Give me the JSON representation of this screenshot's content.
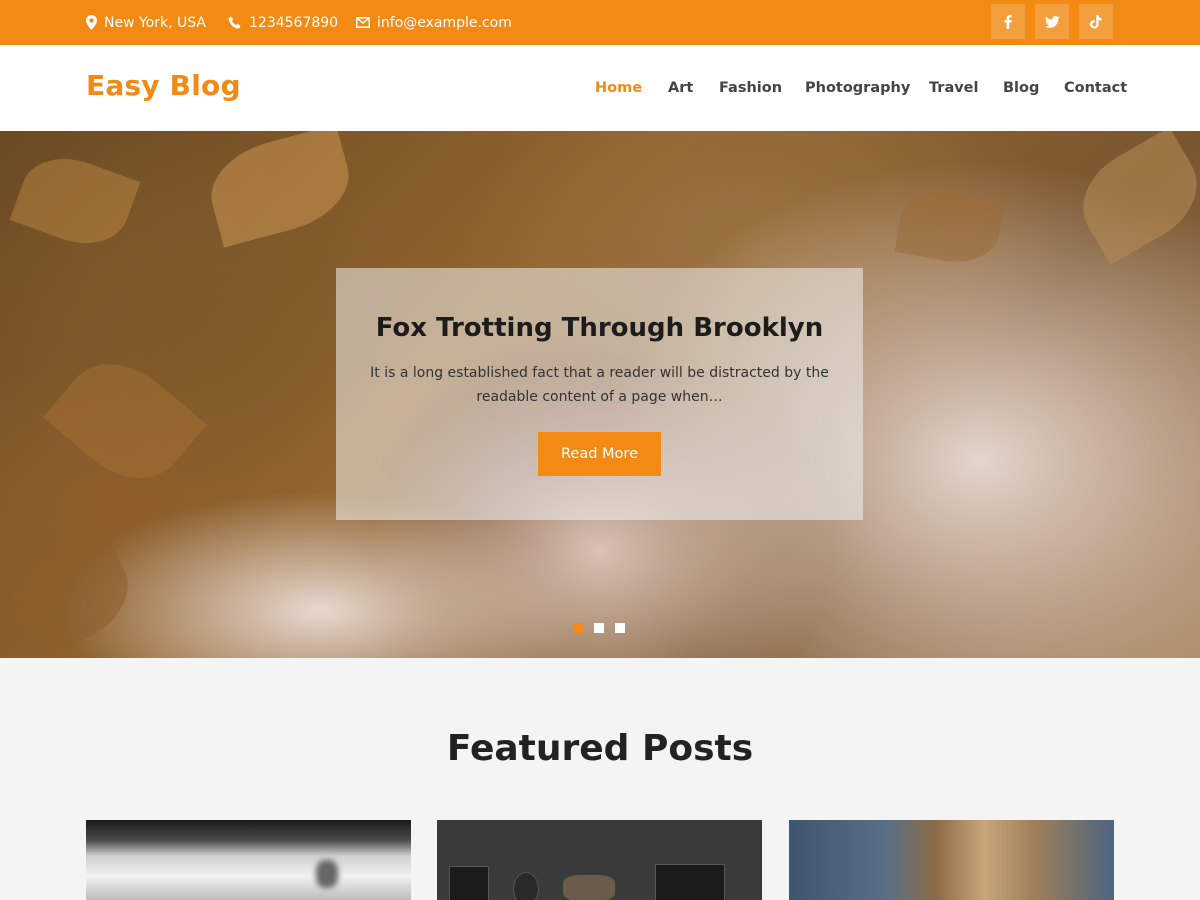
{
  "topbar": {
    "location": "New York, USA",
    "phone": "1234567890",
    "email": "info@example.com",
    "social": [
      "facebook-icon",
      "twitter-icon",
      "tiktok-icon"
    ],
    "bg_color": "#f28a14"
  },
  "header": {
    "logo": "Easy Blog",
    "nav": [
      {
        "label": "Home",
        "active": true
      },
      {
        "label": "Art"
      },
      {
        "label": "Fashion"
      },
      {
        "label": "Photography"
      },
      {
        "label": "Travel"
      },
      {
        "label": "Blog"
      },
      {
        "label": "Contact"
      }
    ]
  },
  "hero": {
    "title": "Fox Trotting Through Brooklyn",
    "excerpt": "It is a long established fact that a reader will be distracted by the readable content of a page when…",
    "button": "Read More",
    "slides": 3,
    "active_slide": 1
  },
  "featured": {
    "title": "Featured Posts"
  },
  "colors": {
    "accent": "#f28a14",
    "text": "#222222",
    "background": "#f4f4f4"
  }
}
